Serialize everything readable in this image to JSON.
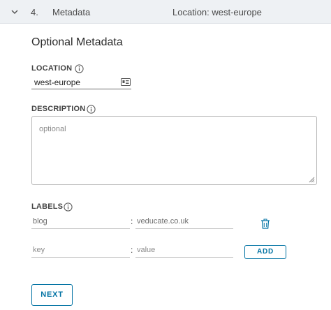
{
  "header": {
    "step_number": "4.",
    "step_title": "Metadata",
    "summary": "Location: west-europe"
  },
  "section_title": "Optional Metadata",
  "location": {
    "label": "LOCATION",
    "value": "west-europe"
  },
  "description": {
    "label": "DESCRIPTION",
    "placeholder": "optional"
  },
  "labels": {
    "label": "LABELS",
    "rows": [
      {
        "key": "blog",
        "value": "veducate.co.uk"
      }
    ],
    "new_row": {
      "key_placeholder": "key",
      "value_placeholder": "value"
    },
    "separator": ":",
    "add_label": "ADD"
  },
  "next_label": "NEXT",
  "colors": {
    "accent": "#0072a3",
    "header_bg": "#eef1f4"
  },
  "icons": [
    "chevron-down-icon",
    "info-icon",
    "card-icon",
    "trash-icon",
    "resize-grip-icon"
  ]
}
